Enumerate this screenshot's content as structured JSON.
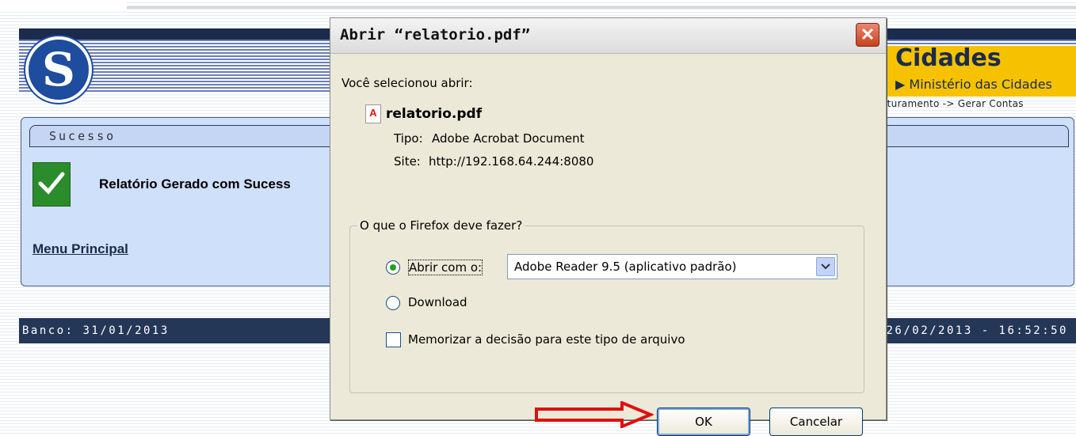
{
  "header": {
    "cidades_title": "Cidades",
    "cidades_sub": "Ministério das Cidades",
    "breadcrumb": "aturamento -> Gerar Contas"
  },
  "content": {
    "tab_label": "Sucesso",
    "success_message": "Relatório Gerado com Sucess",
    "menu_link": "Menu Principal"
  },
  "footer": {
    "left": "Banco: 31/01/2013",
    "right": "26/02/2013 - 16:52:50"
  },
  "dialog": {
    "title": "Abrir “relatorio.pdf”",
    "intro": "Você selecionou abrir:",
    "filename": "relatorio.pdf",
    "type_label": "Tipo:",
    "type_value": "Adobe Acrobat Document",
    "site_label": "Site:",
    "site_value": "http://192.168.64.244:8080",
    "group_legend": "O que o Firefox deve fazer?",
    "open_with_label": "Abrir com o:",
    "open_with_value": "Adobe Reader 9.5 (aplicativo padrão)",
    "download_label": "Download",
    "remember_label": "Memorizar a decisão para este tipo de arquivo",
    "ok_label": "OK",
    "cancel_label": "Cancelar",
    "selected_option": "open_with",
    "remember_checked": false
  },
  "colors": {
    "accent_red": "#e01010",
    "header_dark": "#1a2b4c",
    "cidades_yellow": "#f6c200",
    "success_green": "#2b8c2c"
  },
  "icons": [
    "logo-icon",
    "checkmark-icon",
    "pdf-icon",
    "close-icon",
    "dropdown-arrow-icon",
    "red-arrow-icon"
  ]
}
